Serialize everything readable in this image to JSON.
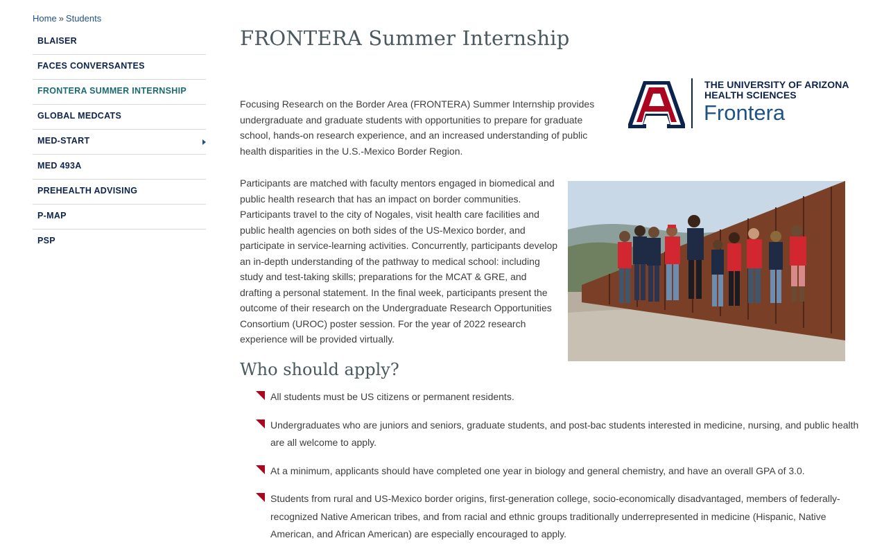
{
  "breadcrumb": {
    "home": "Home",
    "separator": "»",
    "current": "Students"
  },
  "sidebar": {
    "items": [
      {
        "label": "BLAISER"
      },
      {
        "label": "FACES CONVERSANTES"
      },
      {
        "label": "FRONTERA SUMMER INTERNSHIP",
        "active": true
      },
      {
        "label": "GLOBAL MEDCATS"
      },
      {
        "label": "MED-START",
        "has_submenu": true
      },
      {
        "label": "MED 493A"
      },
      {
        "label": "PREHEALTH ADVISING"
      },
      {
        "label": "P-MAP"
      },
      {
        "label": "PSP"
      }
    ]
  },
  "main": {
    "title": "FRONTERA Summer Internship",
    "intro": "Focusing Research on the Border Area (FRONTERA) Summer Internship provides undergraduate and graduate students with opportunities to prepare for graduate school, hands-on research experience, and an increased understanding of public health disparities in the U.S.-Mexico Border Region.",
    "details": "Participants are matched with faculty mentors engaged in biomedical and public health research that has an impact on border communities. Participants travel to the city of Nogales, visit health care facilities and public health agencies on both sides of the US-Mexico border, and participate in service-learning activities. Concurrently, participants develop an in-depth understanding of the pathway to medical school: including study and test-taking skills; preparations for the MCAT & GRE, and drafting a personal statement. In the final week, participants present the outcome of their research on the Undergraduate Research Opportunities Consortium (UROC) poster session.  For the year of 2022 research experience will be provided virtually.",
    "section_title": "Who should apply?",
    "requirements": [
      "All students must be US citizens or permanent residents.",
      "Undergraduates who are juniors and seniors, graduate students, and post-bac students interested in medicine, nursing, and public health are all welcome to apply.",
      "At a minimum, applicants should have completed one year in biology and general chemistry, and have an overall GPA of 3.0.",
      "Students from rural and US-Mexico border origins, first-generation college, socio-economically disadvantaged, members of federally-recognized Native American tribes, and from racial and ethnic groups traditionally underrepresented in medicine (Hispanic, Native American, and African American) are especially encouraged to apply."
    ]
  },
  "logo": {
    "line1": "THE UNIVERSITY OF ARIZONA",
    "line2": "HEALTH SCIENCES",
    "line3": "Frontera"
  },
  "colors": {
    "navy": "#0c234b",
    "link_blue": "#1e5288",
    "active_teal": "#1b6a73",
    "arizona_red": "#ab0520",
    "heading_gray": "#49595e"
  },
  "icons": {
    "bullet": "red-triangle-bullet-icon",
    "submenu": "caret-right-icon",
    "brand": "block-a-icon"
  }
}
